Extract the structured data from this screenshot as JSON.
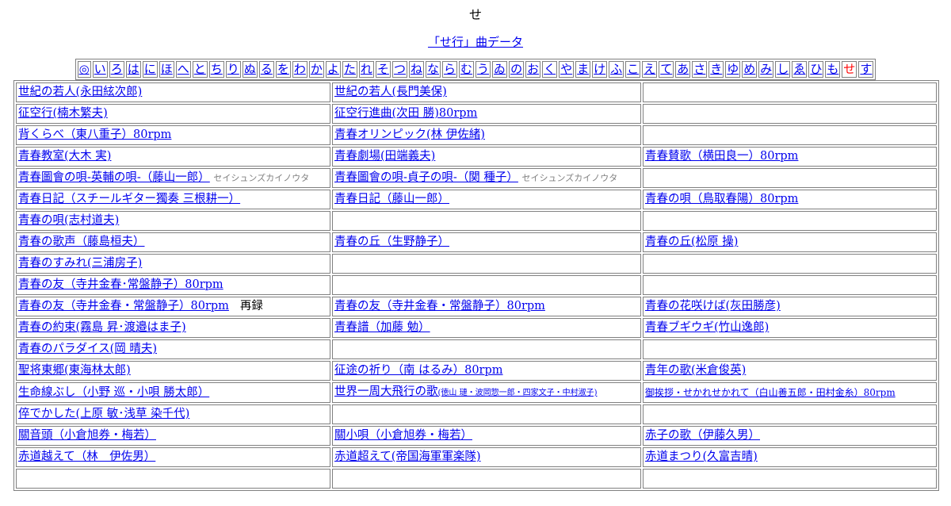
{
  "page_title": "せ",
  "subtitle_link": "「せ行」曲データ",
  "nav": [
    {
      "label": "◎",
      "current": false
    },
    {
      "label": "い",
      "current": false
    },
    {
      "label": "ろ",
      "current": false
    },
    {
      "label": "は",
      "current": false
    },
    {
      "label": "に",
      "current": false
    },
    {
      "label": "ほ",
      "current": false
    },
    {
      "label": "へ",
      "current": false
    },
    {
      "label": "と",
      "current": false
    },
    {
      "label": "ち",
      "current": false
    },
    {
      "label": "り",
      "current": false
    },
    {
      "label": "ぬ",
      "current": false
    },
    {
      "label": "る",
      "current": false
    },
    {
      "label": "を",
      "current": false
    },
    {
      "label": "わ",
      "current": false
    },
    {
      "label": "か",
      "current": false
    },
    {
      "label": "よ",
      "current": false
    },
    {
      "label": "た",
      "current": false
    },
    {
      "label": "れ",
      "current": false
    },
    {
      "label": "そ",
      "current": false
    },
    {
      "label": "つ",
      "current": false
    },
    {
      "label": "ね",
      "current": false
    },
    {
      "label": "な",
      "current": false
    },
    {
      "label": "ら",
      "current": false
    },
    {
      "label": "む",
      "current": false
    },
    {
      "label": "う",
      "current": false
    },
    {
      "label": "ゐ",
      "current": false
    },
    {
      "label": "の",
      "current": false
    },
    {
      "label": "お",
      "current": false
    },
    {
      "label": "く",
      "current": false
    },
    {
      "label": "や",
      "current": false
    },
    {
      "label": "ま",
      "current": false
    },
    {
      "label": "け",
      "current": false
    },
    {
      "label": "ふ",
      "current": false
    },
    {
      "label": "こ",
      "current": false
    },
    {
      "label": "え",
      "current": false
    },
    {
      "label": "て",
      "current": false
    },
    {
      "label": "あ",
      "current": false
    },
    {
      "label": "さ",
      "current": false
    },
    {
      "label": "き",
      "current": false
    },
    {
      "label": "ゆ",
      "current": false
    },
    {
      "label": "め",
      "current": false
    },
    {
      "label": "み",
      "current": false
    },
    {
      "label": "し",
      "current": false
    },
    {
      "label": "ゑ",
      "current": false
    },
    {
      "label": "ひ",
      "current": false
    },
    {
      "label": "も",
      "current": false
    },
    {
      "label": "せ",
      "current": true
    },
    {
      "label": "す",
      "current": false
    }
  ],
  "rows": [
    [
      {
        "link": "世紀の若人(永田絃次郎)"
      },
      {
        "link": "世紀の若人(長門美保)"
      },
      {}
    ],
    [
      {
        "link": "征空行(楠木繁夫)"
      },
      {
        "link": "征空行進曲(次田 勝)80rpm"
      },
      {}
    ],
    [
      {
        "link": "背くらべ（東八重子）80rpm"
      },
      {
        "link": "青春オリンピック(林 伊佐緒)"
      },
      {}
    ],
    [
      {
        "link": "青春教室(大木 実)"
      },
      {
        "link": "青春劇場(田端義夫)"
      },
      {
        "link": "青春賛歌（横田良一）80rpm"
      }
    ],
    [
      {
        "link": "青春圖會の唄-英輔の唄-（藤山一郎）",
        "note": "セイシュンズカイノウタ"
      },
      {
        "link": "青春圖會の唄-貞子の唄-（関 種子）",
        "note": "セイシュンズカイノウタ"
      },
      {}
    ],
    [
      {
        "link": "青春日記（スチールギター獨奏 三根耕一）"
      },
      {
        "link": "青春日記（藤山一郎）"
      },
      {
        "link": "青春の唄（鳥取春陽）80rpm"
      }
    ],
    [
      {
        "link": "青春の唄(志村道夫)"
      },
      {},
      {}
    ],
    [
      {
        "link": "青春の歌声（藤島桓夫）"
      },
      {
        "link": "青春の丘（生野静子）"
      },
      {
        "link": "青春の丘(松原 操)"
      }
    ],
    [
      {
        "link": "青春のすみれ(三浦房子)"
      },
      {},
      {}
    ],
    [
      {
        "link": "青春の友（寺井金春･常盤静子）80rpm"
      },
      {},
      {}
    ],
    [
      {
        "link": "青春の友（寺井金春・常盤静子）80rpm",
        "extra": "再録"
      },
      {
        "link": "青春の友（寺井金春・常盤静子）80rpm"
      },
      {
        "link": "青春の花咲けば(灰田勝彦)"
      }
    ],
    [
      {
        "link": "青春の約束(霧島 昇･渡邉はま子)"
      },
      {
        "link": "青春譜（加藤 勉）"
      },
      {
        "link": "青春ブギウギ(竹山逸郎)"
      }
    ],
    [
      {
        "link": "青春のパラダイス(岡 晴夫)"
      },
      {},
      {}
    ],
    [
      {
        "link": "聖将東郷(東海林太郎)"
      },
      {
        "link": "征途の祈り（南 はるみ）80rpm"
      },
      {
        "link": "青年の歌(米倉俊英)"
      }
    ],
    [
      {
        "link": "生命線ぶし（小野 巡・小唄 勝太郎）"
      },
      {
        "link": "世界一周大飛行の歌",
        "small": "(徳山 璉・波岡惣一郎・四家文子・中村淑子)"
      },
      {
        "link": "御挨拶・せかれせかれて（白山善五郎・田村金糸）80rpm",
        "linkSmall": true
      }
    ],
    [
      {
        "link": "倅でかした(上原 敏･浅草 染千代)"
      },
      {},
      {}
    ],
    [
      {
        "link": "關音頭（小倉旭券・梅若）"
      },
      {
        "link": "關小唄（小倉旭券・梅若）"
      },
      {
        "link": "赤子の歌（伊藤久男）"
      }
    ],
    [
      {
        "link": "赤道越えて（林　伊佐男）"
      },
      {
        "link": "赤道超えて(帝国海軍軍楽隊)"
      },
      {
        "link": "赤道まつり(久富吉晴)"
      }
    ],
    [
      {},
      {},
      {}
    ]
  ]
}
